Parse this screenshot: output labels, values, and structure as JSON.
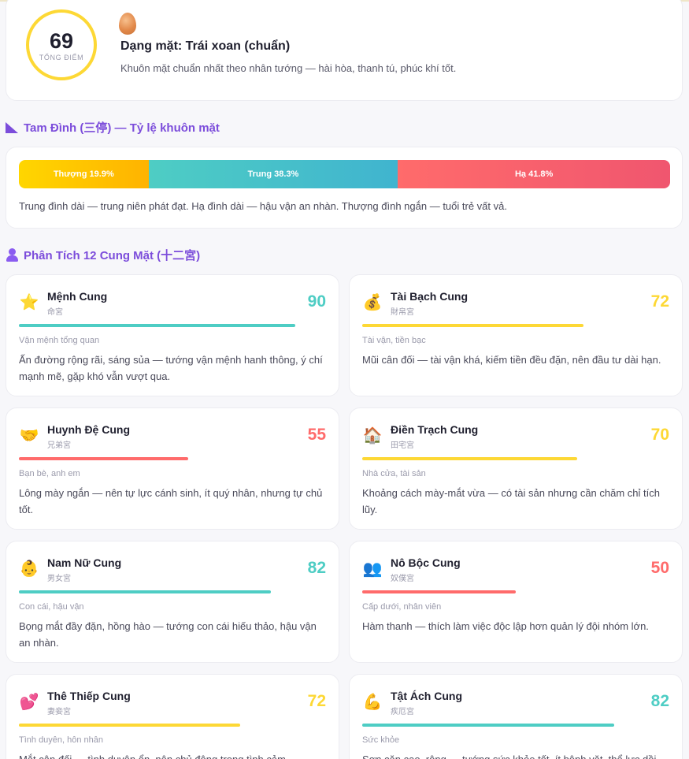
{
  "summary": {
    "score": "69",
    "score_label": "TỔNG ĐIỂM",
    "face_shape_icon": "egg-icon",
    "face_shape_title": "Dạng mặt: Trái xoan (chuẩn)",
    "face_shape_desc": "Khuôn mặt chuẩn nhất theo nhân tướng — hài hòa, thanh tú, phúc khí tốt."
  },
  "tam_dinh": {
    "title": "Tam Đình (三停) — Tỷ lệ khuôn mặt",
    "segments": [
      {
        "label": "Thượng 19.9%",
        "percent": 19.9
      },
      {
        "label": "Trung 38.3%",
        "percent": 38.3
      },
      {
        "label": "Hạ 41.8%",
        "percent": 41.8
      }
    ],
    "note": "Trung đình dài — trung niên phát đạt. Hạ đình dài — hậu vận an nhàn. Thượng đình ngắn — tuổi trẻ vất vả."
  },
  "palaces_section": {
    "title": "Phân Tích 12 Cung Mặt (十二宮)"
  },
  "palaces": [
    {
      "icon": "⭐",
      "name": "Mệnh Cung",
      "han": "命宮",
      "score": "90",
      "level": 0.9,
      "tone": "good",
      "category": "Vận mệnh tổng quan",
      "desc": "Ấn đường rộng rãi, sáng sủa — tướng vận mệnh hanh thông, ý chí mạnh mẽ, gặp khó vẫn vượt qua."
    },
    {
      "icon": "💰",
      "name": "Tài Bạch Cung",
      "han": "財帛宮",
      "score": "72",
      "level": 0.72,
      "tone": "mid",
      "category": "Tài vận, tiền bạc",
      "desc": "Mũi cân đối — tài vận khá, kiếm tiền đều đặn, nên đầu tư dài hạn."
    },
    {
      "icon": "🤝",
      "name": "Huynh Đệ Cung",
      "han": "兄弟宮",
      "score": "55",
      "level": 0.55,
      "tone": "bad",
      "category": "Bạn bè, anh em",
      "desc": "Lông mày ngắn — nên tự lực cánh sinh, ít quý nhân, nhưng tự chủ tốt."
    },
    {
      "icon": "🏠",
      "name": "Điền Trạch Cung",
      "han": "田宅宮",
      "score": "70",
      "level": 0.7,
      "tone": "mid",
      "category": "Nhà cửa, tài sản",
      "desc": "Khoảng cách mày-mắt vừa — có tài sản nhưng cần chăm chỉ tích lũy."
    },
    {
      "icon": "👶",
      "name": "Nam Nữ Cung",
      "han": "男女宮",
      "score": "82",
      "level": 0.82,
      "tone": "good",
      "category": "Con cái, hậu vận",
      "desc": "Bọng mắt đầy đặn, hồng hào — tướng con cái hiếu thảo, hậu vận an nhàn."
    },
    {
      "icon": "👥",
      "name": "Nô Bộc Cung",
      "han": "奴僕宮",
      "score": "50",
      "level": 0.5,
      "tone": "bad",
      "category": "Cấp dưới, nhân viên",
      "desc": "Hàm thanh — thích làm việc độc lập hơn quản lý đội nhóm lớn."
    },
    {
      "icon": "💕",
      "name": "Thê Thiếp Cung",
      "han": "妻妾宮",
      "score": "72",
      "level": 0.72,
      "tone": "mid",
      "category": "Tình duyên, hôn nhân",
      "desc": "Mắt cân đối — tình duyên ổn, nên chủ động trong tình cảm."
    },
    {
      "icon": "💪",
      "name": "Tật Ách Cung",
      "han": "疾厄宮",
      "score": "82",
      "level": 0.82,
      "tone": "good",
      "category": "Sức khỏe",
      "desc": "Sơn căn cao, rộng — tướng sức khỏe tốt, ít bệnh vặt, thể lực dồi dào."
    }
  ]
}
